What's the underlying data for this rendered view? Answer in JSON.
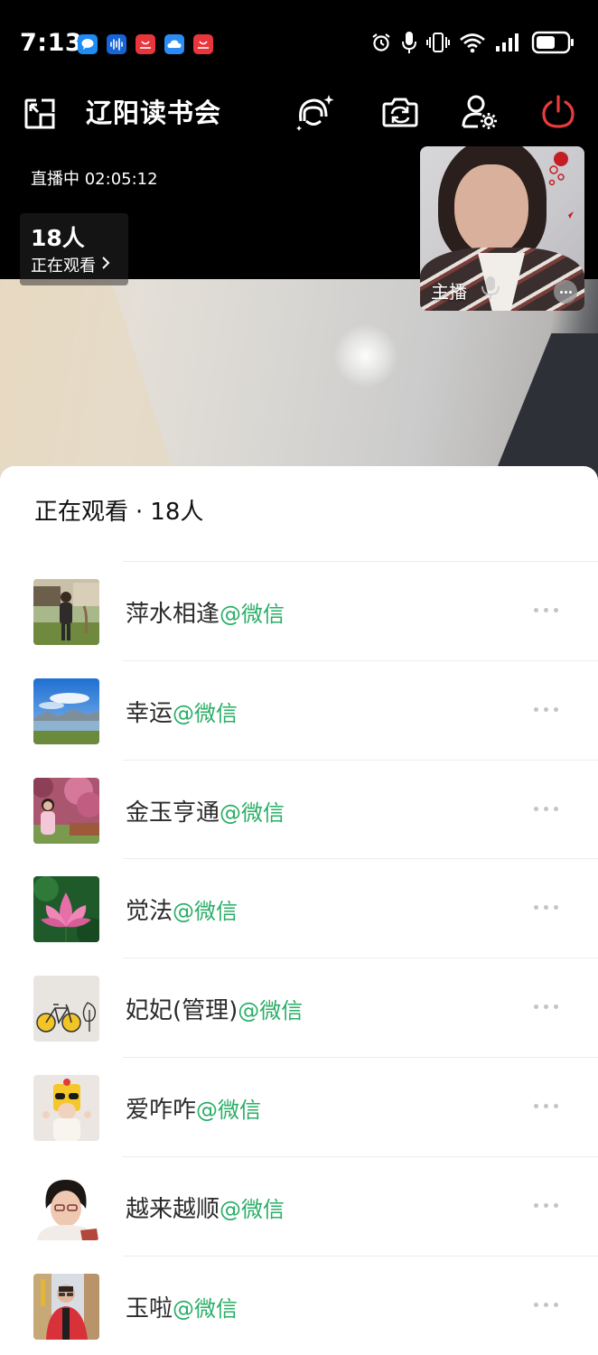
{
  "status_bar": {
    "time": "7:13",
    "notification_icons": [
      {
        "name": "chat-bubble-icon",
        "color": "#1f8cf2"
      },
      {
        "name": "voice-wave-icon",
        "color": "#1763d8"
      },
      {
        "name": "shop-bag-icon",
        "color": "#e8363c"
      },
      {
        "name": "cloud-icon",
        "color": "#2c8cf4"
      },
      {
        "name": "shop-bag-icon",
        "color": "#e8363c"
      }
    ],
    "system_icons": [
      "alarm-icon",
      "microphone-icon",
      "vibrate-icon",
      "wifi-icon",
      "signal-icon",
      "battery-icon"
    ]
  },
  "header": {
    "title": "辽阳读书会",
    "actions": [
      "minimize-window-icon",
      "beauty-effect-icon",
      "switch-camera-icon",
      "user-settings-icon",
      "power-end-icon"
    ],
    "end_color": "#e83b3b"
  },
  "live": {
    "status": "直播中 02:05:12",
    "viewer_count": "18人",
    "viewer_link": "正在观看"
  },
  "host": {
    "label": "主播"
  },
  "panel": {
    "title": "正在观看",
    "separator": "·",
    "count": "18人",
    "viewers": [
      {
        "name": "萍水相逢",
        "tag": "@微信",
        "avatar": "man-garden-photo"
      },
      {
        "name": "幸运",
        "tag": "@微信",
        "avatar": "lake-mountain-photo"
      },
      {
        "name": "金玉亨通",
        "tag": "@微信",
        "avatar": "woman-blossoms-photo"
      },
      {
        "name": "觉法",
        "tag": "@微信",
        "avatar": "lotus-flower-photo"
      },
      {
        "name": "妃妃(管理)",
        "tag": "@微信",
        "avatar": "bicycle-sketch"
      },
      {
        "name": "爱咋咋",
        "tag": "@微信",
        "avatar": "child-sunglasses-photo"
      },
      {
        "name": "越来越顺",
        "tag": "@微信",
        "avatar": "woman-portrait-photo"
      },
      {
        "name": "玉啦",
        "tag": "@微信",
        "avatar": "man-red-jacket-photo"
      }
    ],
    "tag_color": "#2aae67"
  }
}
